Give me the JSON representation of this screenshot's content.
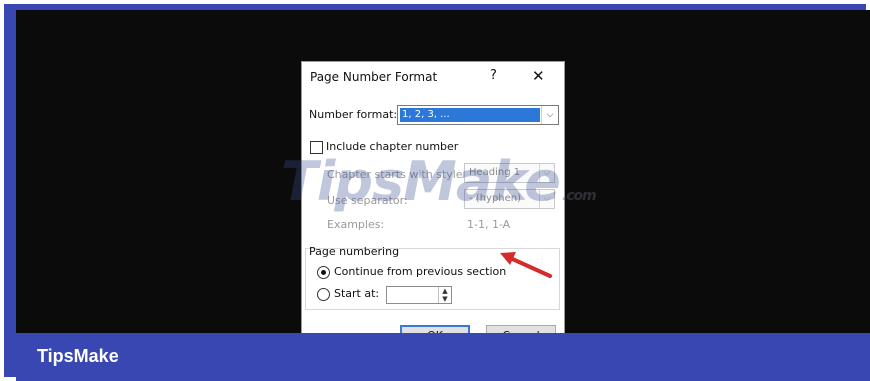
{
  "brand": {
    "name": "TipsMake"
  },
  "watermark": {
    "main": "TipsMake",
    "suffix": ".com"
  },
  "dialog": {
    "title": "Page Number Format",
    "help_glyph": "?",
    "close_glyph": "✕",
    "number_format": {
      "label": "Number format:",
      "value": "1, 2, 3, ...",
      "arrow": "⌵"
    },
    "include_chapter": {
      "label": "Include chapter number",
      "checked": false
    },
    "chapter_starts": {
      "label": "Chapter starts with style:",
      "value": "Heading 1"
    },
    "separator": {
      "label": "Use separator:",
      "value": "-   (hyphen)"
    },
    "examples": {
      "label": "Examples:",
      "value": "1-1, 1-A"
    },
    "page_numbering": {
      "label": "Page numbering",
      "continue": {
        "label": "Continue from previous section",
        "selected": true
      },
      "start_at": {
        "label": "Start at:",
        "value": "",
        "selected": false
      }
    },
    "ok_label": "OK",
    "cancel_label": "Cancel"
  },
  "colors": {
    "frame": "#3947b3",
    "screen": "#0b0b0b",
    "selection": "#2b78d8",
    "annotation_arrow": "#d62b2b"
  }
}
